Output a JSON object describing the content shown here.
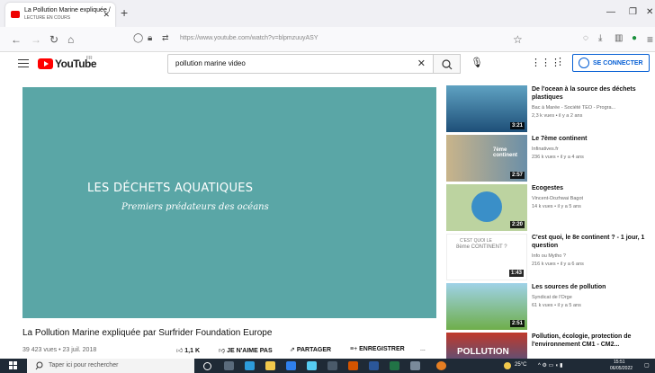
{
  "browser": {
    "tab_title": "La Pollution Marine expliquée / ",
    "tab_status": "LECTURE EN COURS",
    "url": "https://www.youtube.com/watch?v=blpmzuuyASY"
  },
  "youtube": {
    "logo_text": "YouTube",
    "logo_country": "FR",
    "search_value": "pollution marine video",
    "signin_label": "SE CONNECTER"
  },
  "player": {
    "title": "LES DÉCHETS AQUATIQUES",
    "subtitle": "Premiers prédateurs des océans",
    "background_color": "#5aa6a6"
  },
  "video": {
    "title": "La Pollution Marine expliquée par Surfrider Foundation Europe",
    "meta": "39 423 vues • 23 juil. 2018",
    "likes": "1,1 K",
    "dislike_label": "JE N'AIME PAS",
    "share_label": "PARTAGER",
    "save_label": "ENREGISTRER",
    "more": "..."
  },
  "recommendations": [
    {
      "title": "De l'ocean à la source des déchets plastiques",
      "channel": "Bac à Marée - Société TEO - Progra...",
      "meta": "2,3 k vues • il y a 2 ans",
      "duration": "3:21"
    },
    {
      "title": "Le 7ème continent",
      "channel": "Infinatives.fr",
      "meta": "236 k vues • il y a 4 ans",
      "duration": "2:57"
    },
    {
      "title": "Ecogestes",
      "channel": "Vincent-Dozhwai Bagot",
      "meta": "14 k vues • il y a 5 ans",
      "duration": "2:20"
    },
    {
      "title": "C'est quoi, le 8e continent ? - 1 jour, 1 question",
      "channel": "Info ou Mytho ?",
      "meta": "216 k vues • il y a 6 ans",
      "duration": "1:43"
    },
    {
      "title": "Les sources de pollution",
      "channel": "Syndicat de l'Orge",
      "meta": "61 k vues • il y a 5 ans",
      "duration": "2:51"
    },
    {
      "title": "Pollution, écologie, protection de l'environnement CM1 - CM2...",
      "channel": "",
      "meta": "",
      "duration": ""
    }
  ],
  "thumb_texts": {
    "t2_overlay": "7ème continent",
    "t4_line1": "C'EST QUOI LE",
    "t4_line2": "8ème CONTINENT ?",
    "t6_overlay": "POLLUTION"
  },
  "taskbar": {
    "search_placeholder": "Taper ici pour rechercher",
    "weather": "25°C",
    "time": "15:51",
    "date": "06/05/2022"
  }
}
